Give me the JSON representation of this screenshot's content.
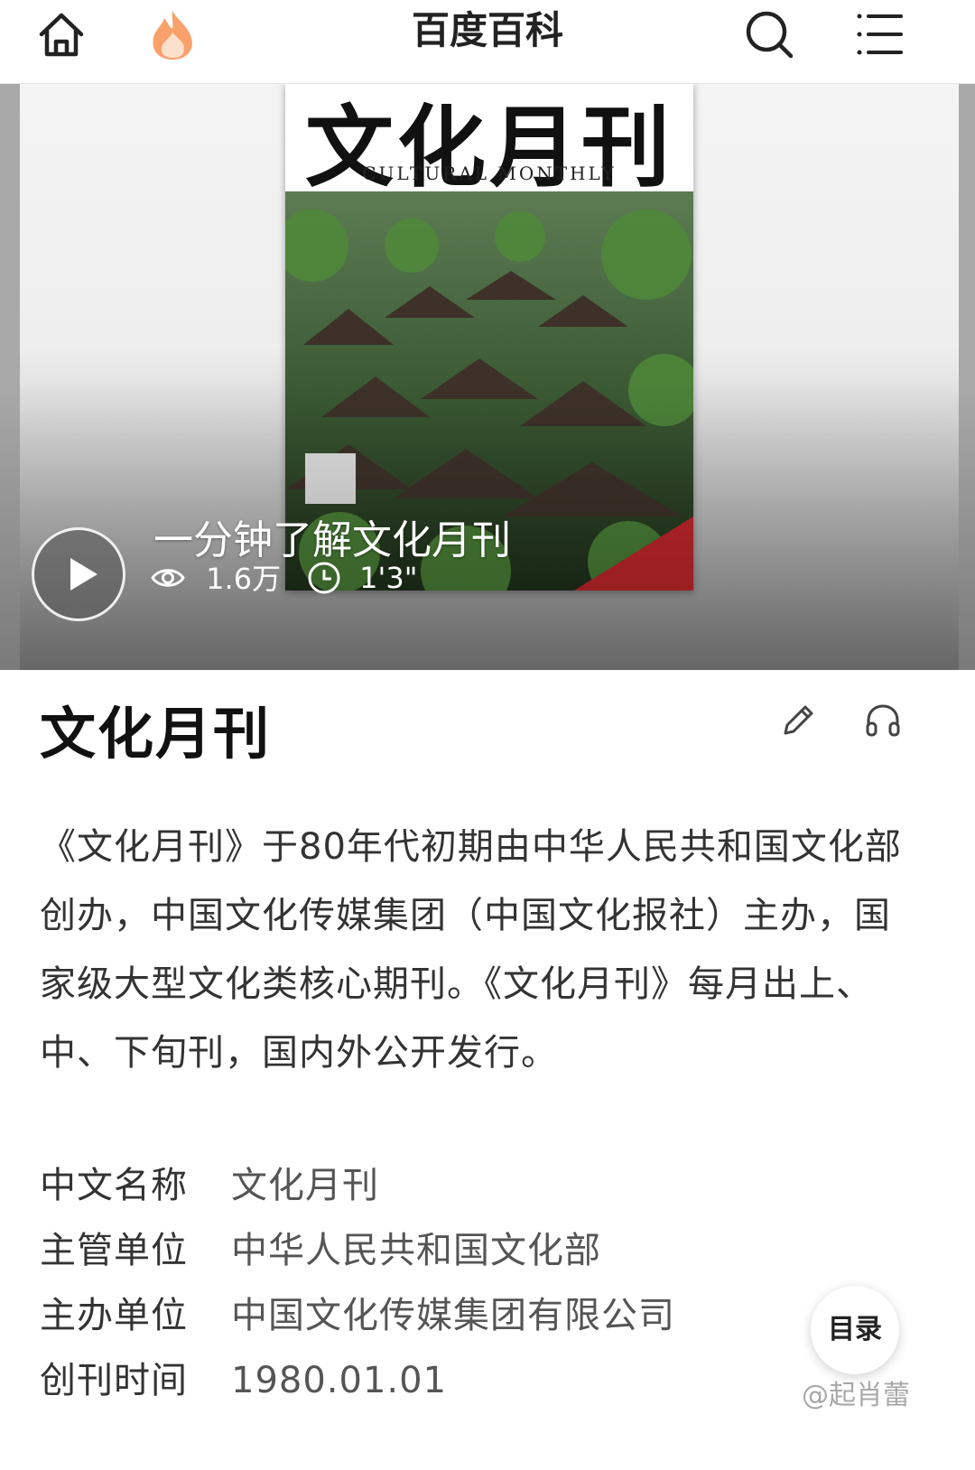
{
  "header": {
    "title": "百度百科",
    "icons": [
      "home-icon",
      "hot-flame-icon",
      "search-icon",
      "menu-icon"
    ]
  },
  "video": {
    "cover": {
      "masthead": "文化月刊",
      "subtitle": "CULTURAL MONTHLY"
    },
    "title": "一分钟了解文化月刊",
    "views": "1.6万",
    "duration": "1'3\""
  },
  "entry": {
    "title": "文化月刊",
    "summary": "《文化月刊》于80年代初期由中华人民共和国文化部创办，中国文化传媒集团（中国文化报社）主办，国家级大型文化类核心期刊。《文化月刊》每月出上、中、下旬刊，国内外公开发行。"
  },
  "infobox": [
    {
      "key": "中文名称",
      "value": "文化月刊"
    },
    {
      "key": "主管单位",
      "value": "中华人民共和国文化部"
    },
    {
      "key": "主办单位",
      "value": "中国文化传媒集团有限公司"
    },
    {
      "key": "创刊时间",
      "value": "1980.01.01"
    }
  ],
  "toc_button": "目录",
  "watermark": "@起肖蕾",
  "colors": {
    "accent_flame": "#f79a5a",
    "text": "#222222",
    "muted": "#555555"
  }
}
